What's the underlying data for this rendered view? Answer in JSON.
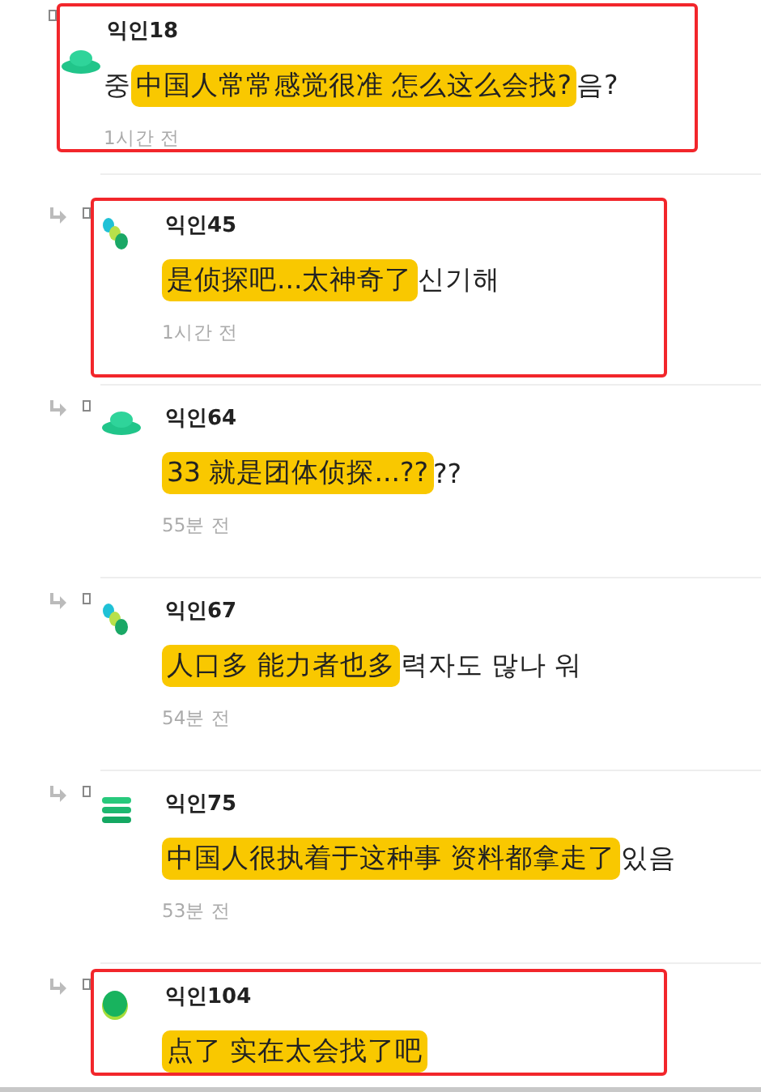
{
  "comments": [
    {
      "user": "익인18",
      "reply": false,
      "kind": "mound",
      "prefix": "중",
      "translation": "中国人常常感觉很准  怎么这么会找?",
      "suffix": "음?",
      "time": "1시간 전",
      "highlighted": true
    },
    {
      "user": "익인45",
      "reply": true,
      "kind": "pills",
      "translation": "是侦探吧...太神奇了",
      "suffix": "신기해",
      "time": "1시간 전",
      "highlighted": true
    },
    {
      "user": "익인64",
      "reply": true,
      "kind": "mound",
      "translation": "33 就是团体侦探...??",
      "suffix": "??",
      "time": "55분 전",
      "highlighted": false
    },
    {
      "user": "익인67",
      "reply": true,
      "kind": "pills",
      "translation": "人口多 能力者也多",
      "suffix": "력자도 많나 워",
      "time": "54분 전",
      "highlighted": false
    },
    {
      "user": "익인75",
      "reply": true,
      "kind": "stack",
      "translation": "中国人很执着于这种事 资料都拿走了",
      "suffix": "있음",
      "time": "53분 전",
      "highlighted": false
    },
    {
      "user": "익인104",
      "reply": true,
      "kind": "blob",
      "translation": "点了 实在太会找了吧",
      "highlighted": true
    }
  ]
}
